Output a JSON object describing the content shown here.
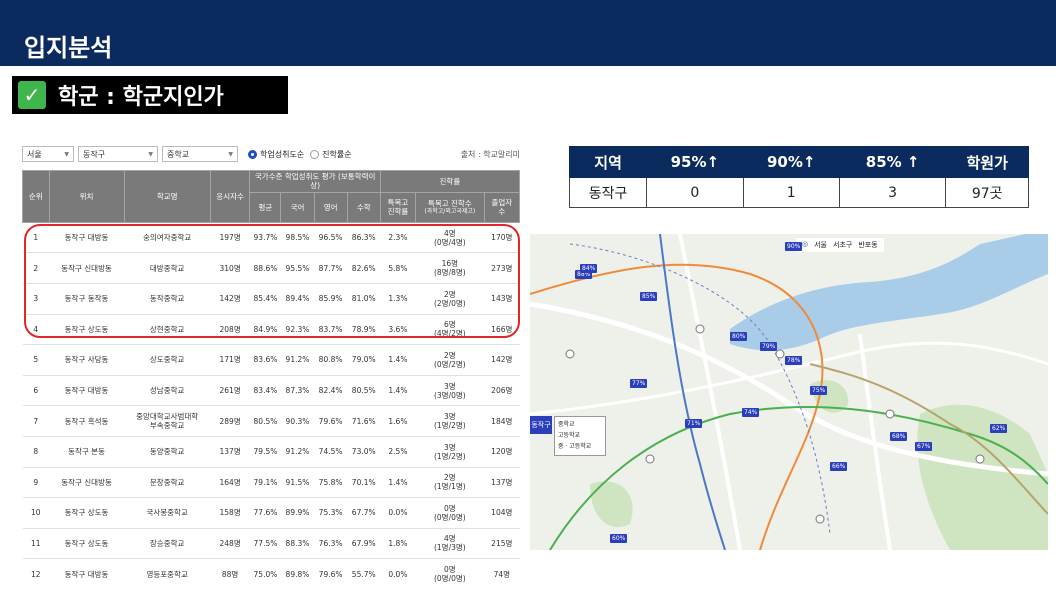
{
  "header": {
    "title": "입지분석"
  },
  "section": {
    "check": "✓",
    "label": "학군 : 학군지인가"
  },
  "filters": {
    "region": "서울",
    "district": "동작구",
    "school_type": "중학교",
    "sort_option_1": "학업성취도순",
    "sort_option_2": "진학률순",
    "source": "출처 : 학교알리미"
  },
  "school_table": {
    "headers": {
      "rank": "순위",
      "location": "위치",
      "school": "학교명",
      "applicants": "응시자수",
      "national_group": "국가수준 학업성취도 평가 (보통학력이상)",
      "avg": "평균",
      "korean": "국어",
      "english": "영어",
      "math": "수학",
      "advancement_group": "진학률",
      "special_rate_1": "특목고",
      "special_rate_2": "진학률",
      "special_count_1": "특목고 진학수",
      "special_count_2": "(과학고/외고국제고)",
      "graduates_1": "졸업자",
      "graduates_2": "수"
    },
    "rows": [
      {
        "rank": "1",
        "location": "동작구 대방동",
        "school": "숭의여자중학교",
        "school2": "",
        "applicants": "197명",
        "avg": "93.7%",
        "korean": "98.5%",
        "english": "96.5%",
        "math": "86.3%",
        "special_rate": "2.3%",
        "special_count": "4명",
        "special_detail": "(0명/4명)",
        "graduates": "170명"
      },
      {
        "rank": "2",
        "location": "동작구 신대방동",
        "school": "대방중학교",
        "school2": "",
        "applicants": "310명",
        "avg": "88.6%",
        "korean": "95.5%",
        "english": "87.7%",
        "math": "82.6%",
        "special_rate": "5.8%",
        "special_count": "16명",
        "special_detail": "(8명/8명)",
        "graduates": "273명"
      },
      {
        "rank": "3",
        "location": "동작구 동작동",
        "school": "동작중학교",
        "school2": "",
        "applicants": "142명",
        "avg": "85.4%",
        "korean": "89.4%",
        "english": "85.9%",
        "math": "81.0%",
        "special_rate": "1.3%",
        "special_count": "2명",
        "special_detail": "(2명/0명)",
        "graduates": "143명"
      },
      {
        "rank": "4",
        "location": "동작구 상도동",
        "school": "상현중학교",
        "school2": "",
        "applicants": "208명",
        "avg": "84.9%",
        "korean": "92.3%",
        "english": "83.7%",
        "math": "78.9%",
        "special_rate": "3.6%",
        "special_count": "6명",
        "special_detail": "(4명/2명)",
        "graduates": "166명"
      },
      {
        "rank": "5",
        "location": "동작구 사당동",
        "school": "상도중학교",
        "school2": "",
        "applicants": "171명",
        "avg": "83.6%",
        "korean": "91.2%",
        "english": "80.8%",
        "math": "79.0%",
        "special_rate": "1.4%",
        "special_count": "2명",
        "special_detail": "(0명/2명)",
        "graduates": "142명"
      },
      {
        "rank": "6",
        "location": "동작구 대방동",
        "school": "성남중학교",
        "school2": "",
        "applicants": "261명",
        "avg": "83.4%",
        "korean": "87.3%",
        "english": "82.4%",
        "math": "80.5%",
        "special_rate": "1.4%",
        "special_count": "3명",
        "special_detail": "(3명/0명)",
        "graduates": "206명"
      },
      {
        "rank": "7",
        "location": "동작구 흑석동",
        "school": "중앙대학교사범대학",
        "school2": "부속중학교",
        "applicants": "289명",
        "avg": "80.5%",
        "korean": "90.3%",
        "english": "79.6%",
        "math": "71.6%",
        "special_rate": "1.6%",
        "special_count": "3명",
        "special_detail": "(1명/2명)",
        "graduates": "184명"
      },
      {
        "rank": "8",
        "location": "동작구 본동",
        "school": "동양중학교",
        "school2": "",
        "applicants": "137명",
        "avg": "79.5%",
        "korean": "91.2%",
        "english": "74.5%",
        "math": "73.0%",
        "special_rate": "2.5%",
        "special_count": "3명",
        "special_detail": "(1명/2명)",
        "graduates": "120명"
      },
      {
        "rank": "9",
        "location": "동작구 신대방동",
        "school": "문창중학교",
        "school2": "",
        "applicants": "164명",
        "avg": "79.1%",
        "korean": "91.5%",
        "english": "75.8%",
        "math": "70.1%",
        "special_rate": "1.4%",
        "special_count": "2명",
        "special_detail": "(1명/1명)",
        "graduates": "137명"
      },
      {
        "rank": "10",
        "location": "동작구 상도동",
        "school": "국사봉중학교",
        "school2": "",
        "applicants": "158명",
        "avg": "77.6%",
        "korean": "89.9%",
        "english": "75.3%",
        "math": "67.7%",
        "special_rate": "0.0%",
        "special_count": "0명",
        "special_detail": "(0명/0명)",
        "graduates": "104명"
      },
      {
        "rank": "11",
        "location": "동작구 상도동",
        "school": "장승중학교",
        "school2": "",
        "applicants": "248명",
        "avg": "77.5%",
        "korean": "88.3%",
        "english": "76.3%",
        "math": "67.9%",
        "special_rate": "1.8%",
        "special_count": "4명",
        "special_detail": "(1명/3명)",
        "graduates": "215명"
      },
      {
        "rank": "12",
        "location": "동작구 대방동",
        "school": "영등포중학교",
        "school2": "",
        "applicants": "88명",
        "avg": "75.0%",
        "korean": "89.8%",
        "english": "79.6%",
        "math": "55.7%",
        "special_rate": "0.0%",
        "special_count": "0명",
        "special_detail": "(0명/0명)",
        "graduates": "74명"
      }
    ]
  },
  "summary": {
    "headers": [
      "지역",
      "95%↑",
      "90%↑",
      "85% ↑",
      "학원가"
    ],
    "row": [
      "동작구",
      "0",
      "1",
      "3",
      "97곳"
    ]
  },
  "map": {
    "filter_labels": [
      "서울",
      "서초구",
      "반포동"
    ],
    "pin_values": [
      "90%",
      "88%",
      "85%",
      "84%",
      "80%",
      "79%",
      "78%",
      "77%",
      "75%",
      "74%",
      "71%",
      "68%",
      "67%",
      "66%",
      "62%",
      "60%"
    ],
    "popup": [
      "중학교",
      "고등학교",
      "중 · 고등학교"
    ],
    "district_tag": "동작구",
    "colors": {
      "water": "#a9cde8",
      "park": "#cfe5c1",
      "road": "#ffffff",
      "subway_orange": "#f08a3c",
      "subway_green": "#4caf50",
      "subway_blue": "#4a78c8",
      "pin": "#2b3fbd"
    }
  }
}
